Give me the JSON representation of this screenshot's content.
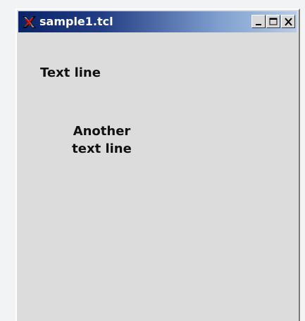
{
  "window": {
    "title": "sample1.tcl"
  },
  "icons": {
    "app": "x-logo-icon",
    "minimize": "minimize-icon",
    "maximize": "maximize-icon",
    "close": "close-icon"
  },
  "content": {
    "label_1": "Text line",
    "label_2": "Another\ntext line"
  },
  "colors": {
    "window_background": "#dcdcdc",
    "title_text": "#ffffff"
  }
}
